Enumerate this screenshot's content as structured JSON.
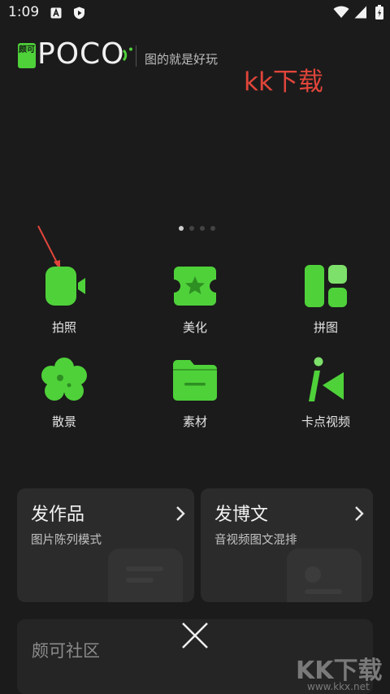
{
  "status_bar": {
    "time": "1:09",
    "left_icons": [
      "font-notification-icon",
      "shield-play-icon"
    ],
    "right_icons": [
      "wifi-icon",
      "signal-icon",
      "battery-icon"
    ]
  },
  "header": {
    "logo_badge": "颇可",
    "logo_word": "POCO",
    "slogan": "图的就是好玩"
  },
  "watermark_text": "kk下载",
  "pager": {
    "count": 4,
    "active_index": 0
  },
  "tools": [
    {
      "label": "拍照",
      "icon": "camera-icon"
    },
    {
      "label": "美化",
      "icon": "ticket-star-icon"
    },
    {
      "label": "拼图",
      "icon": "collage-icon"
    },
    {
      "label": "散景",
      "icon": "flower-icon"
    },
    {
      "label": "素材",
      "icon": "folder-icon"
    },
    {
      "label": "卡点视频",
      "icon": "video-cut-icon"
    }
  ],
  "cards": [
    {
      "title": "发作品",
      "subtitle": "图片陈列模式"
    },
    {
      "title": "发博文",
      "subtitle": "音视频图文混排"
    }
  ],
  "community": {
    "title": "颇可社区"
  },
  "corner_watermark": {
    "big": "KK下载",
    "small": "www.kkx.net"
  },
  "colors": {
    "accent": "#4fd13a",
    "background": "#1b1b1b",
    "card": "#2b2b2b",
    "watermark": "#e0453a"
  }
}
